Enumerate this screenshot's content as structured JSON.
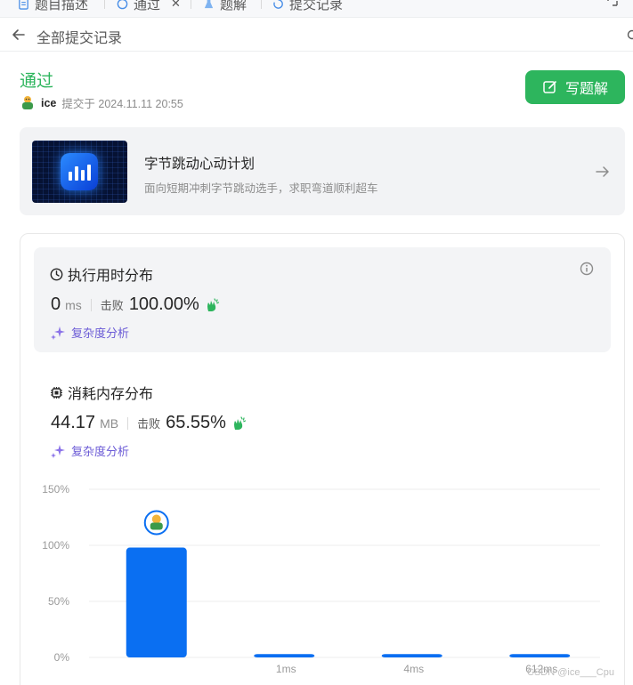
{
  "tabs": [
    {
      "label": "题目描述",
      "icon": "description-icon"
    },
    {
      "label": "通过",
      "icon": "check-circle-icon",
      "closable": true
    },
    {
      "label": "题解",
      "icon": "flask-icon"
    },
    {
      "label": "提交记录",
      "icon": "history-icon"
    }
  ],
  "header": {
    "back_label": "全部提交记录"
  },
  "submission": {
    "status": "通过",
    "username": "ice",
    "submitted_text": "提交于 2024.11.11 20:55"
  },
  "solution_button": {
    "label": "写题解"
  },
  "promo": {
    "title": "字节跳动心动计划",
    "subtitle": "面向短期冲刺字节跳动选手，求职弯道顺利超车"
  },
  "runtime": {
    "title": "执行用时分布",
    "value": "0",
    "unit": "ms",
    "beat_label": "击败",
    "percent": "100.00%",
    "analysis_label": "复杂度分析"
  },
  "memory": {
    "title": "消耗内存分布",
    "value": "44.17",
    "unit": "MB",
    "beat_label": "击败",
    "percent": "65.55%",
    "analysis_label": "复杂度分析"
  },
  "chart_data": {
    "type": "bar",
    "categories": [
      "",
      "1ms",
      "4ms",
      "612ms"
    ],
    "values": [
      98,
      3,
      3,
      3
    ],
    "ylim": [
      0,
      150
    ],
    "yticks": [
      "0%",
      "50%",
      "100%",
      "150%"
    ],
    "highlight_index": 0,
    "grid": true,
    "bar_color": "#0a6ff2"
  },
  "colors": {
    "accent_green": "#2db55d",
    "purple": "#6b5bd6",
    "bar_blue": "#0a6ff2"
  },
  "watermark": "CSDN @ice___Cpu"
}
